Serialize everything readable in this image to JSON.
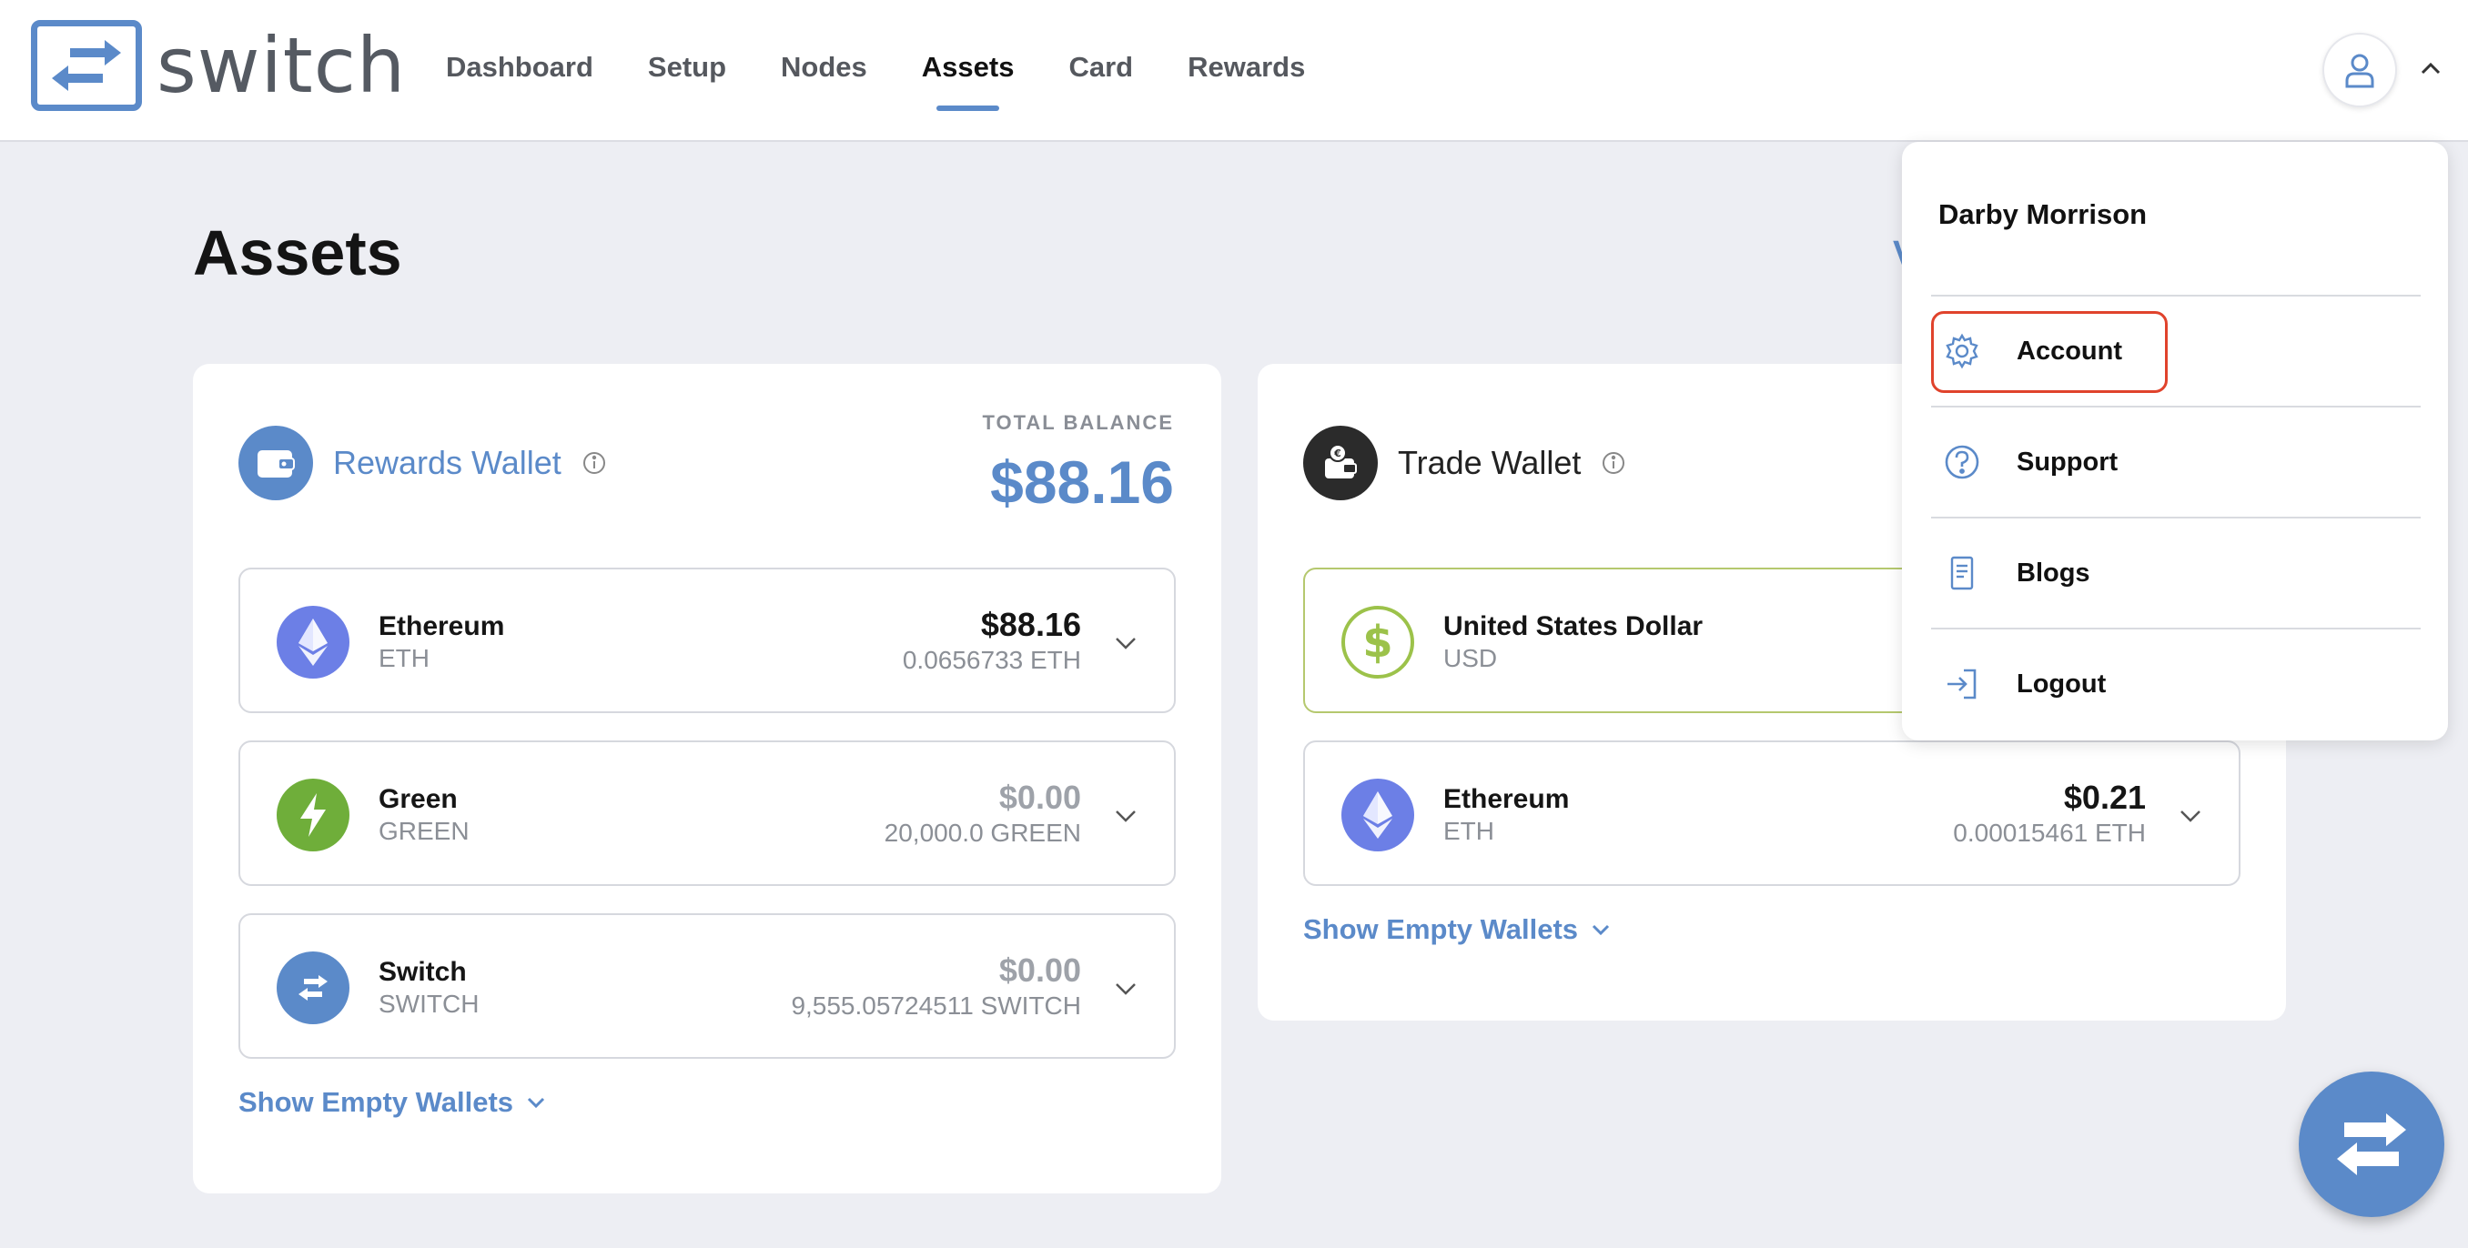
{
  "brand": {
    "name": "switch"
  },
  "nav": {
    "items": [
      {
        "label": "Dashboard",
        "active": false
      },
      {
        "label": "Setup",
        "active": false
      },
      {
        "label": "Nodes",
        "active": false
      },
      {
        "label": "Assets",
        "active": true
      },
      {
        "label": "Card",
        "active": false
      },
      {
        "label": "Rewards",
        "active": false
      }
    ]
  },
  "page": {
    "title": "Assets",
    "partial_link": "V"
  },
  "rewards_wallet": {
    "name": "Rewards Wallet",
    "total_label": "TOTAL BALANCE",
    "total_value": "$88.16",
    "assets": [
      {
        "name": "Ethereum",
        "symbol": "ETH",
        "amount": "$88.16",
        "sub": "0.0656733 ETH",
        "icon": "ethereum-icon"
      },
      {
        "name": "Green",
        "symbol": "GREEN",
        "amount": "$0.00",
        "sub": "20,000.0 GREEN",
        "icon": "green-bolt-icon"
      },
      {
        "name": "Switch",
        "symbol": "SWITCH",
        "amount": "$0.00",
        "sub": "9,555.05724511 SWITCH",
        "icon": "switch-icon"
      }
    ],
    "show_empty": "Show Empty Wallets"
  },
  "trade_wallet": {
    "name": "Trade Wallet",
    "assets": [
      {
        "name": "United States Dollar",
        "symbol": "USD",
        "icon": "dollar-icon"
      },
      {
        "name": "Ethereum",
        "symbol": "ETH",
        "amount": "$0.21",
        "sub": "0.00015461 ETH",
        "icon": "ethereum-icon"
      }
    ],
    "show_empty": "Show Empty Wallets"
  },
  "user_menu": {
    "user_name": "Darby Morrison",
    "items": [
      {
        "label": "Account",
        "icon": "gear-icon"
      },
      {
        "label": "Support",
        "icon": "help-circle-icon"
      },
      {
        "label": "Blogs",
        "icon": "document-icon"
      },
      {
        "label": "Logout",
        "icon": "logout-icon"
      }
    ]
  },
  "colors": {
    "accent": "#5b8ac9",
    "ethereum": "#6c7fe6",
    "green_token": "#6fae3a",
    "usd_border": "#b5c86e",
    "highlight": "#e0432c"
  }
}
